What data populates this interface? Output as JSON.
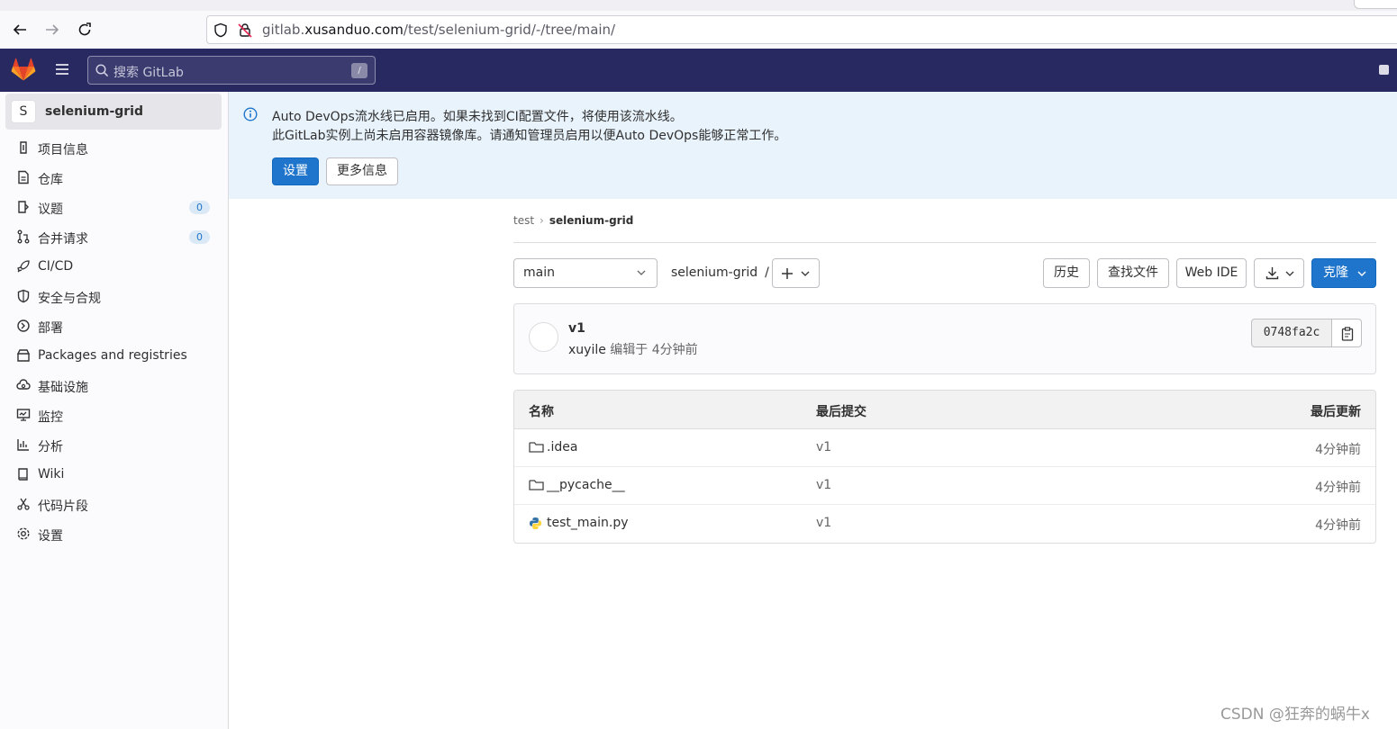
{
  "browser": {
    "url_prefix": "gitlab.",
    "url_domain": "xusanduo.com",
    "url_path": "/test/selenium-grid/-/tree/main/"
  },
  "header": {
    "search_placeholder": "搜索 GitLab",
    "search_shortcut": "/"
  },
  "sidebar": {
    "project_initial": "S",
    "project_name": "selenium-grid",
    "items": [
      {
        "label": "项目信息",
        "icon": "info-circle-icon"
      },
      {
        "label": "仓库",
        "icon": "document-icon"
      },
      {
        "label": "议题",
        "icon": "issues-icon",
        "badge": "0"
      },
      {
        "label": "合并请求",
        "icon": "merge-request-icon",
        "badge": "0"
      },
      {
        "label": "CI/CD",
        "icon": "rocket-icon"
      },
      {
        "label": "安全与合规",
        "icon": "shield-icon"
      },
      {
        "label": "部署",
        "icon": "deploy-icon"
      },
      {
        "label": "Packages and registries",
        "icon": "package-icon"
      },
      {
        "label": "基础设施",
        "icon": "cloud-gear-icon"
      },
      {
        "label": "监控",
        "icon": "monitor-icon"
      },
      {
        "label": "分析",
        "icon": "chart-icon"
      },
      {
        "label": "Wiki",
        "icon": "book-icon"
      },
      {
        "label": "代码片段",
        "icon": "scissors-icon"
      },
      {
        "label": "设置",
        "icon": "gear-icon"
      }
    ]
  },
  "alert": {
    "line1": "Auto DevOps流水线已启用。如果未找到CI配置文件，将使用该流水线。",
    "line2": "此GitLab实例上尚未启用容器镜像库。请通知管理员启用以便Auto DevOps能够正常工作。",
    "settings_label": "设置",
    "more_label": "更多信息"
  },
  "breadcrumb": {
    "parent": "test",
    "current": "selenium-grid"
  },
  "toolbar": {
    "branch": "main",
    "path": "selenium-grid",
    "path_sep": "/",
    "history": "历史",
    "find_file": "查找文件",
    "web_ide": "Web IDE",
    "clone": "克隆"
  },
  "commit": {
    "title": "v1",
    "author": "xuyile",
    "meta": " 编辑于 4分钟前",
    "sha": "0748fa2c"
  },
  "files": {
    "headers": {
      "name": "名称",
      "last_commit": "最后提交",
      "last_update": "最后更新"
    },
    "rows": [
      {
        "name": ".idea",
        "type": "folder",
        "commit": "v1",
        "updated": "4分钟前"
      },
      {
        "name": "__pycache__",
        "type": "folder",
        "commit": "v1",
        "updated": "4分钟前"
      },
      {
        "name": "test_main.py",
        "type": "python",
        "commit": "v1",
        "updated": "4分钟前"
      }
    ]
  },
  "watermark": "CSDN @狂奔的蜗牛x",
  "colors": {
    "header_bg": "#292961",
    "primary": "#1f75cb",
    "alert_bg": "#e9f3fc"
  }
}
